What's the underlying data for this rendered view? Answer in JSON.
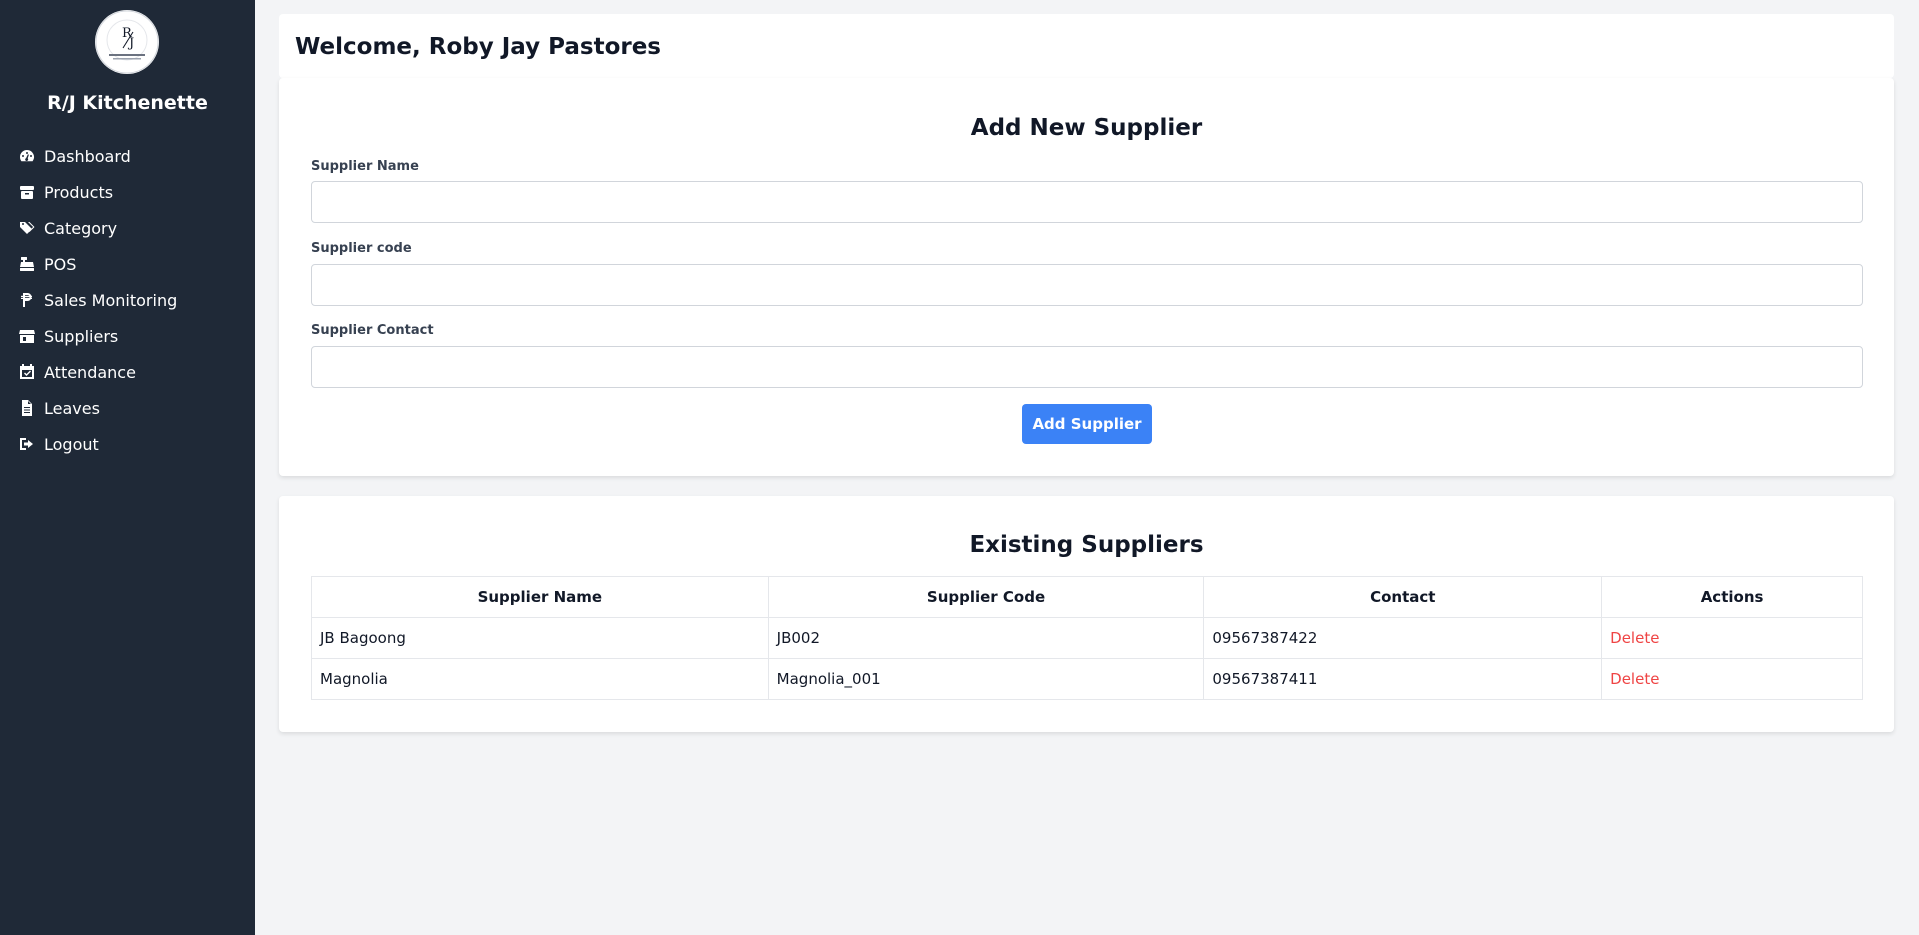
{
  "sidebar": {
    "brand": "R/J Kitchenette",
    "logo_text": "R/J",
    "items": [
      {
        "label": "Dashboard",
        "icon": "gauge-icon"
      },
      {
        "label": "Products",
        "icon": "box-icon"
      },
      {
        "label": "Category",
        "icon": "tags-icon"
      },
      {
        "label": "POS",
        "icon": "cash-register-icon"
      },
      {
        "label": "Sales Monitoring",
        "icon": "peso-icon"
      },
      {
        "label": "Suppliers",
        "icon": "store-icon"
      },
      {
        "label": "Attendance",
        "icon": "calendar-check-icon"
      },
      {
        "label": "Leaves",
        "icon": "file-icon"
      },
      {
        "label": "Logout",
        "icon": "sign-out-icon"
      }
    ]
  },
  "header": {
    "welcome": "Welcome, Roby Jay Pastores"
  },
  "form": {
    "title": "Add New Supplier",
    "name_label": "Supplier Name",
    "name_value": "",
    "code_label": "Supplier code",
    "code_value": "",
    "contact_label": "Supplier Contact",
    "contact_value": "",
    "submit_label": "Add Supplier"
  },
  "suppliers": {
    "title": "Existing Suppliers",
    "columns": [
      "Supplier Name",
      "Supplier Code",
      "Contact",
      "Actions"
    ],
    "rows": [
      {
        "name": "JB Bagoong",
        "code": "JB002",
        "contact": "09567387422",
        "action": "Delete"
      },
      {
        "name": "Magnolia",
        "code": "Magnolia_001",
        "contact": "09567387411",
        "action": "Delete"
      }
    ]
  },
  "colors": {
    "sidebar_bg": "#1f2937",
    "page_bg": "#f3f4f6",
    "primary_button": "#3b82f6",
    "delete_link": "#ef4444"
  }
}
